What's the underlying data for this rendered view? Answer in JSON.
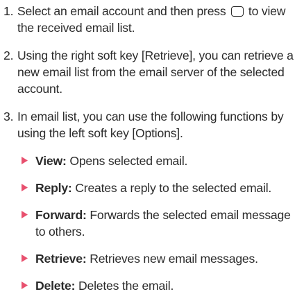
{
  "accent_color": "#e8506e",
  "steps": [
    {
      "number": "1.",
      "text_before_icon": "Select an email account and then press",
      "icon": "ok-key-icon",
      "text_after_icon": "to view the received email list."
    },
    {
      "number": "2.",
      "text": "Using the right soft key [Retrieve], you can retrieve a new email list from the email server of the selected account."
    },
    {
      "number": "3.",
      "text": "In email list, you can use the following functions by using the left soft key [Options]."
    }
  ],
  "functions": [
    {
      "icon": "triangle-bullet-icon",
      "term": "View:",
      "description": "Opens selected email."
    },
    {
      "icon": "triangle-bullet-icon",
      "term": "Reply:",
      "description": "Creates a reply to the selected email."
    },
    {
      "icon": "triangle-bullet-icon",
      "term": "Forward:",
      "description": "Forwards the selected email message to others."
    },
    {
      "icon": "triangle-bullet-icon",
      "term": "Retrieve:",
      "description": "Retrieves new email messages."
    },
    {
      "icon": "triangle-bullet-icon",
      "term": "Delete:",
      "description": "Deletes the email."
    }
  ]
}
